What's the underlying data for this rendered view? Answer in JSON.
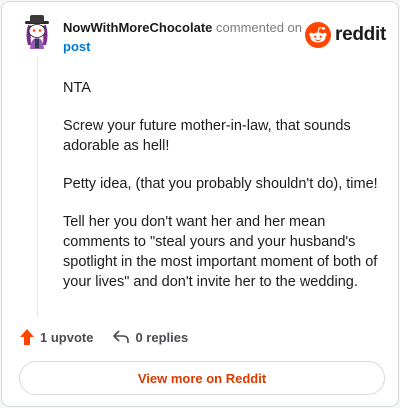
{
  "header": {
    "username": "NowWithMoreChocolate",
    "action_text": "commented on",
    "post_link": "post"
  },
  "brand": {
    "wordmark": "reddit",
    "icon": "reddit-alien-icon",
    "color": "#ff4500"
  },
  "comment": {
    "paragraphs": [
      "NTA",
      "Screw your future mother-in-law, that sounds adorable as hell!",
      "Petty idea, (that you probably shouldn't do), time!",
      "Tell her you don't want her and her mean comments to \"steal yours and your husband's spotlight in the most important moment of both of your lives\" and don't invite her to the wedding."
    ]
  },
  "actions": {
    "upvote_label": "1 upvote",
    "upvote_icon": "upvote-arrow-icon",
    "reply_label": "0 replies",
    "reply_icon": "reply-arrow-icon"
  },
  "footer": {
    "view_more_label": "View more on Reddit",
    "accent_color": "#d93a00"
  }
}
